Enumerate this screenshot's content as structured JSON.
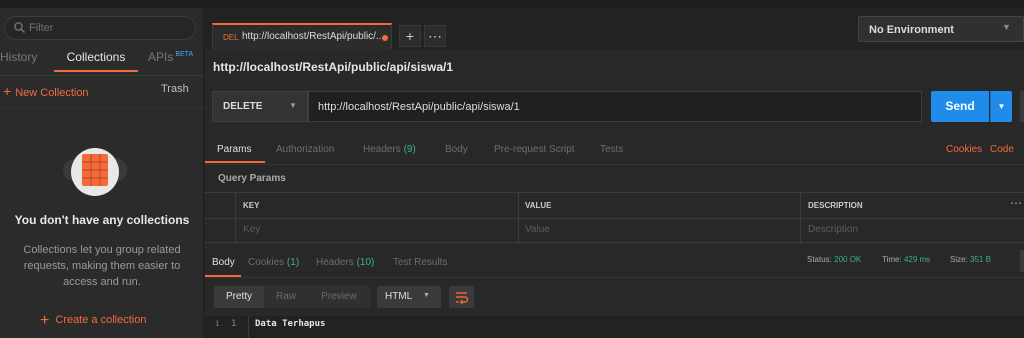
{
  "sidebar": {
    "filter_placeholder": "Filter",
    "tabs": {
      "history": "History",
      "collections": "Collections",
      "apis": "APIs",
      "apis_badge": "BETA"
    },
    "new_collection": "New Collection",
    "trash": "Trash",
    "empty_title": "You don't have any collections",
    "empty_desc": "Collections let you group related requests, making them easier to access and run.",
    "create_collection": "Create a collection"
  },
  "tab": {
    "method": "DEL",
    "url": "http://localhost/RestApi/public/..."
  },
  "environment": "No Environment",
  "request": {
    "title": "http://localhost/RestApi/public/api/siswa/1",
    "method": "DELETE",
    "url": "http://localhost/RestApi/public/api/siswa/1",
    "send": "Send"
  },
  "request_tabs": {
    "params": "Params",
    "authorization": "Authorization",
    "headers": "Headers",
    "headers_count": "(9)",
    "body": "Body",
    "prerequest": "Pre-request Script",
    "tests": "Tests",
    "cookies": "Cookies",
    "code": "Code"
  },
  "query_params": {
    "title": "Query Params",
    "columns": {
      "key": "KEY",
      "value": "VALUE",
      "description": "DESCRIPTION"
    },
    "placeholders": {
      "key": "Key",
      "value": "Value",
      "description": "Description"
    }
  },
  "response": {
    "tabs": {
      "body": "Body",
      "cookies": "Cookies",
      "cookies_count": "(1)",
      "headers": "Headers",
      "headers_count": "(10)",
      "tests": "Test Results"
    },
    "status_label": "Status:",
    "status": "200 OK",
    "time_label": "Time:",
    "time": "429 ms",
    "size_label": "Size:",
    "size": "351 B",
    "formats": {
      "pretty": "Pretty",
      "raw": "Raw",
      "preview": "Preview"
    },
    "language": "HTML",
    "line_info": "i",
    "line_number": "1",
    "body_text": "Data Terhapus"
  },
  "colors": {
    "accent": "#f26b3a",
    "send": "#1f8ceb",
    "success": "#3cb47a"
  }
}
